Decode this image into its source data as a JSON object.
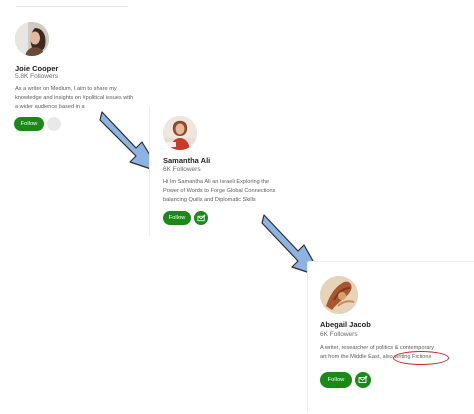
{
  "profiles": [
    {
      "name": "Joie Cooper",
      "followers": "5.8K Followers",
      "bio_lines": [
        "As a writer on Medium, I aim to share my",
        "knowledge and insights on #political issues with",
        "a wider audience based in a"
      ],
      "follow_label": "Follow"
    },
    {
      "name": "Samantha Ali",
      "followers": "6K Followers",
      "bio_lines": [
        "Hi Im Samantha Ali an Israeli Exploring the",
        "Power of Words to Forge Global Connections",
        "balancing Quills and Diplomatic Skills"
      ],
      "follow_label": "Follow"
    },
    {
      "name": "Abegail Jacob",
      "followers": "6K Followers",
      "bio_lines": [
        "A writer, researcher of politics & contemporary",
        "art from the Middle East, also writing Fictions"
      ],
      "follow_label": "Follow"
    }
  ],
  "colors": {
    "follow_green": "#1a8917",
    "arrow_blue": "#8db3e2",
    "arrow_outline": "#2f2f2f",
    "highlight_red": "#d9232a"
  },
  "icons": {
    "subscribe": "mail-plus-icon",
    "arrow": "diagonal-down-right-arrow-icon"
  }
}
